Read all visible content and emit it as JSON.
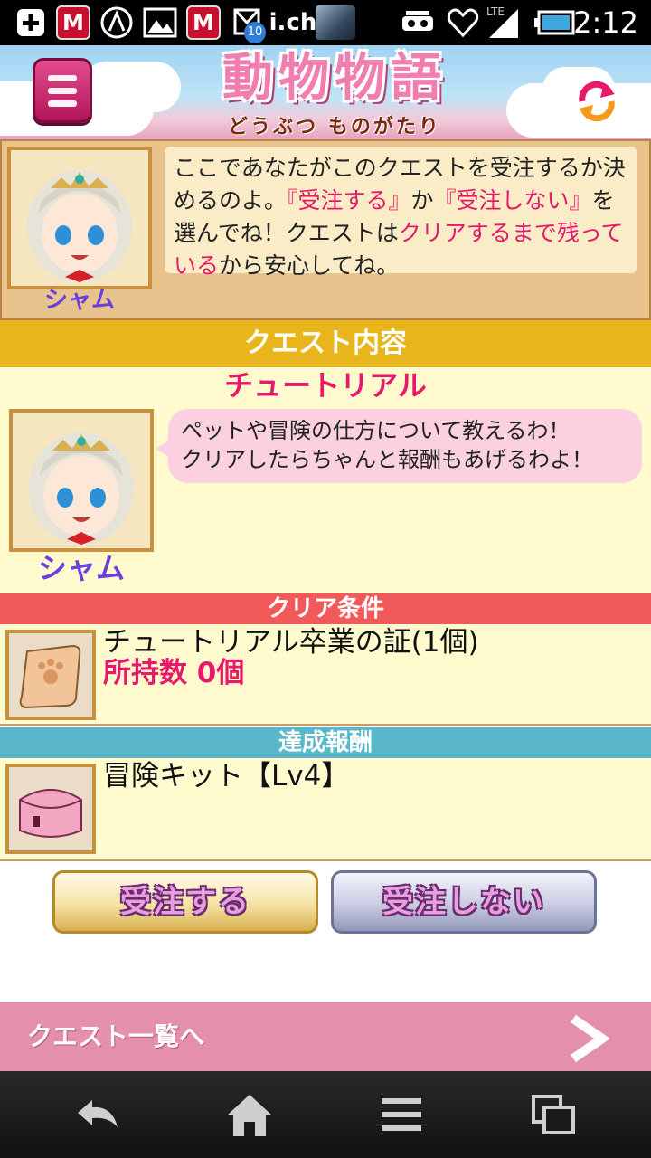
{
  "status_bar": {
    "time": "2:12",
    "network": "LTE",
    "notification_badge": "10",
    "app_label": "i.ch",
    "icons": [
      "add-icon",
      "mcafee-icon",
      "app-icon",
      "gallery-icon",
      "mcafee-icon",
      "mail-icon",
      "ich-icon",
      "vr-icon",
      "heart-icon",
      "signal-icon",
      "battery-icon"
    ]
  },
  "header": {
    "logo_title": "動物物語",
    "logo_subtitle": "どうぶつ ものがたり",
    "menu_icon": "hamburger-icon",
    "refresh_icon": "refresh-icon"
  },
  "intro": {
    "character_name": "シャム",
    "message_parts": [
      "ここであなたがこのクエストを受注するか決めるのよ。",
      "『受注する』",
      "か",
      "『受注しない』",
      "を選んでね！クエストは",
      "クリアするまで残っている",
      "から安心してね。"
    ]
  },
  "quest": {
    "section_label": "クエスト内容",
    "title": "チュートリアル",
    "character_name": "シャム",
    "message_line1": "ペットや冒険の仕方について教えるわ！",
    "message_line2": "クリアしたらちゃんと報酬もあげるわよ！"
  },
  "clear_condition": {
    "section_label": "クリア条件",
    "item_name": "チュートリアル卒業の証(1個)",
    "owned": "所持数 0個",
    "item_icon": "scroll-icon"
  },
  "reward": {
    "section_label": "達成報酬",
    "item_name": "冒険キット【Lv4】",
    "item_icon": "pink-box-icon"
  },
  "actions": {
    "accept_label": "受注する",
    "decline_label": "受注しない"
  },
  "footer": {
    "questlist_label": "クエスト一覧へ"
  },
  "colors": {
    "accent_pink": "#e8196a",
    "section_gold": "#e9b51c",
    "section_red": "#f2595a",
    "section_teal": "#59b7c9",
    "footer_pink": "#e58fae"
  }
}
